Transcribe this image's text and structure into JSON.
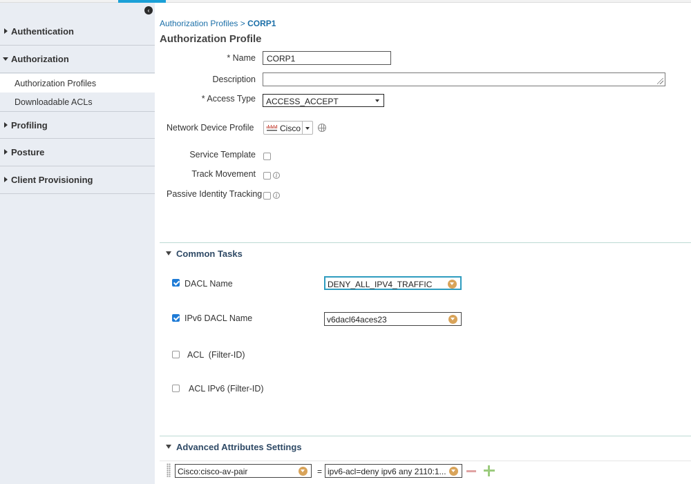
{
  "sidebar": {
    "sections": [
      {
        "label": "Authentication",
        "expanded": false
      },
      {
        "label": "Authorization",
        "expanded": true
      },
      {
        "label": "Profiling",
        "expanded": false
      },
      {
        "label": "Posture",
        "expanded": false
      },
      {
        "label": "Client Provisioning",
        "expanded": false
      }
    ],
    "authorization_items": [
      {
        "label": "Authorization Profiles",
        "active": true
      },
      {
        "label": "Downloadable ACLs",
        "active": false
      }
    ]
  },
  "breadcrumb": {
    "parent": "Authorization Profiles",
    "separator": ">",
    "current": "CORP1"
  },
  "page_title": "Authorization Profile",
  "form": {
    "name_label": "* Name",
    "name_value": "CORP1",
    "description_label": "Description",
    "description_value": "",
    "access_type_label": "* Access Type",
    "access_type_value": "ACCESS_ACCEPT",
    "ndp_label": "Network Device Profile",
    "ndp_value": "Cisco",
    "service_template_label": "Service Template",
    "track_movement_label": "Track Movement",
    "passive_identity_label": "Passive Identity Tracking",
    "info_glyph": "i"
  },
  "common_tasks": {
    "title": "Common Tasks",
    "dacl_label": "DACL Name",
    "dacl_value": "DENY_ALL_IPV4_TRAFFIC",
    "ipv6_dacl_label": "IPv6 DACL Name",
    "ipv6_dacl_value": "v6dacl64aces23",
    "acl_label": "ACL  (Filter-ID)",
    "acl_ipv6_label": "ACL IPv6 (Filter-ID)"
  },
  "advanced": {
    "title": "Advanced Attributes Settings",
    "attribute": "Cisco:cisco-av-pair",
    "operator": "=",
    "value": "ipv6-acl=deny ipv6 any 2110:1..."
  },
  "colors": {
    "accent": "#1ba0d7",
    "checkbox": "#1e7bd6",
    "dropdown": "#d9a45a",
    "link": "#1b6fa8"
  }
}
